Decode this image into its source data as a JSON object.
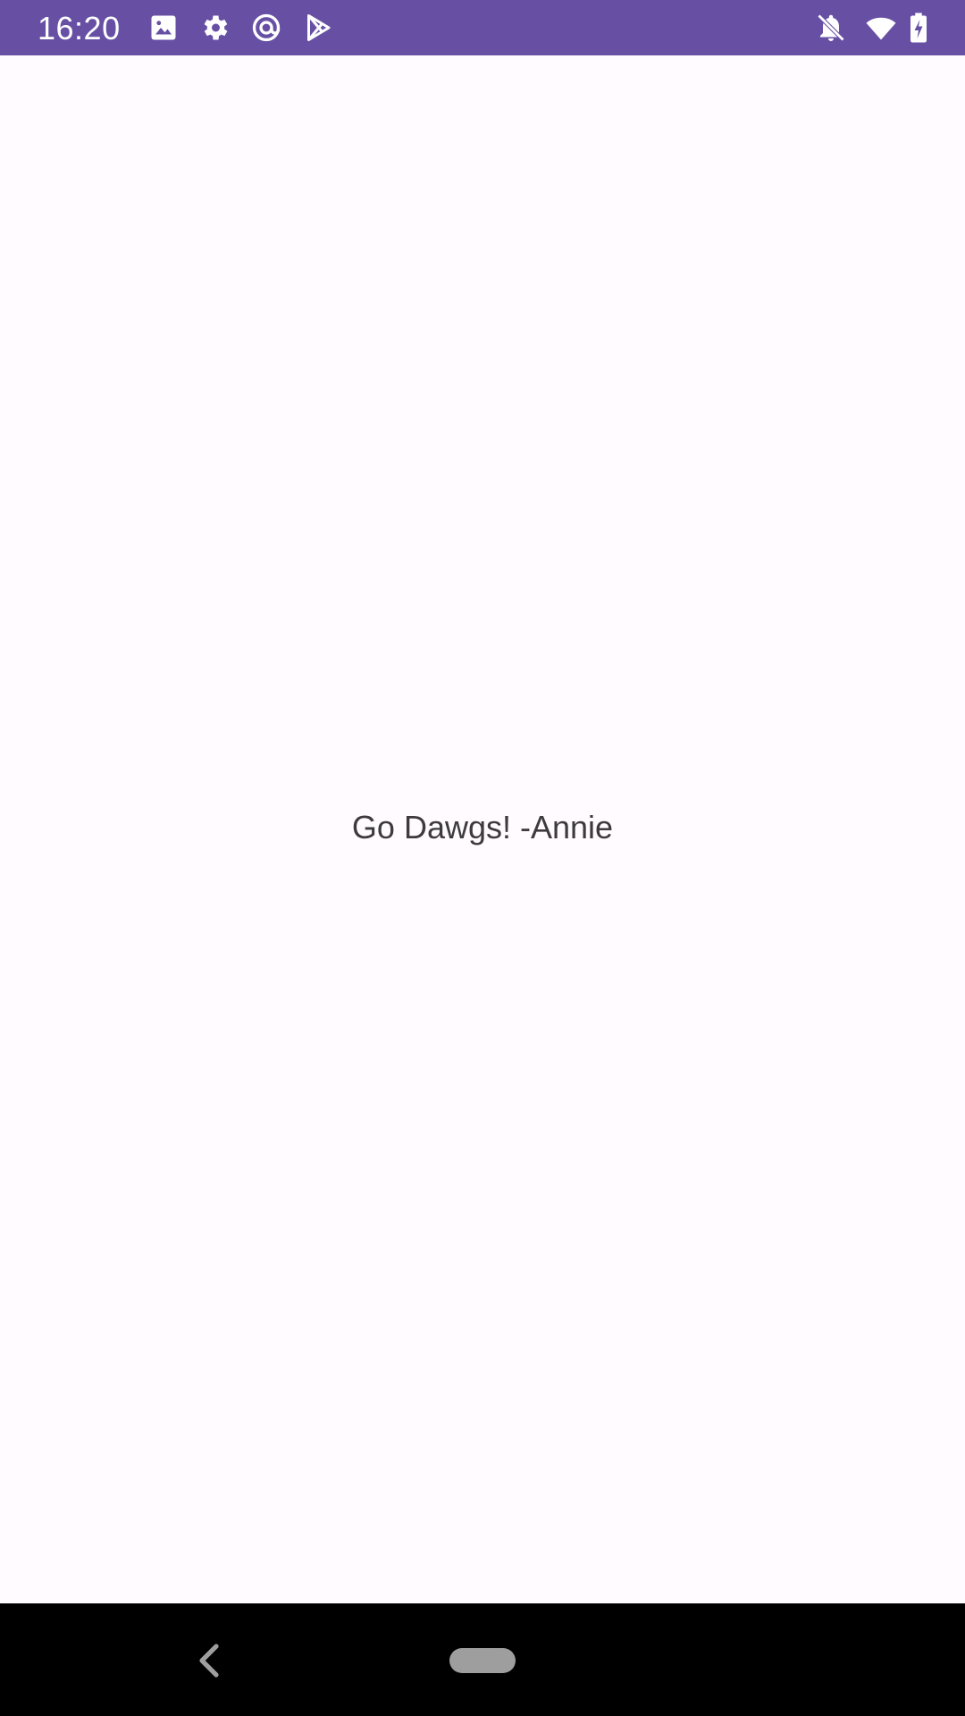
{
  "status_bar": {
    "time": "16:20",
    "background_color": "#6750a4",
    "left_icons": [
      "image-icon",
      "settings-gear-icon",
      "at-sign-icon",
      "play-store-icon"
    ],
    "right_icons": [
      "notifications-off-icon",
      "wifi-icon",
      "battery-charging-icon"
    ]
  },
  "main": {
    "message": "Go Dawgs! -Annie",
    "background_color": "#fffbfe"
  },
  "nav_bar": {
    "buttons": [
      "back-icon",
      "home-pill"
    ]
  }
}
